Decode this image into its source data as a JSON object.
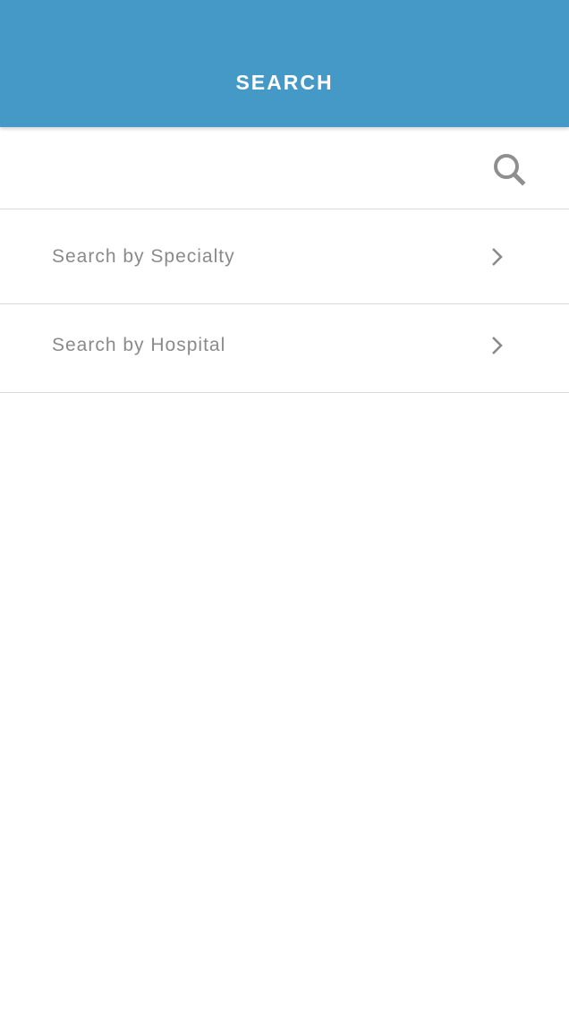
{
  "header": {
    "title": "SEARCH"
  },
  "search": {
    "value": "",
    "placeholder": "",
    "icon": "search-icon"
  },
  "menu": {
    "items": [
      {
        "label": "Search by Specialty",
        "icon": "chevron-right-icon"
      },
      {
        "label": "Search by Hospital",
        "icon": "chevron-right-icon"
      }
    ]
  },
  "colors": {
    "header_background": "#4499c7",
    "header_text": "#ffffff",
    "item_text": "#8a8a8a",
    "icon": "#8f8f8f",
    "divider": "#d9d9d9"
  }
}
